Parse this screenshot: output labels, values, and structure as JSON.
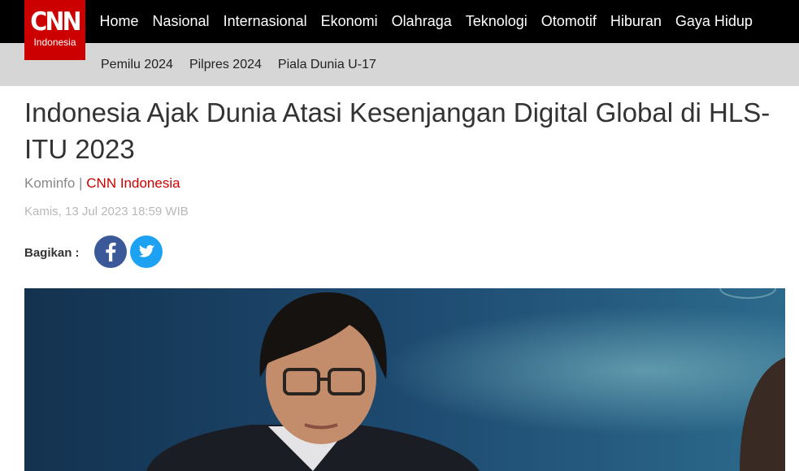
{
  "logo": {
    "mark": "CNN",
    "subtitle": "Indonesia",
    "color": "#cc0000"
  },
  "nav": {
    "main": [
      {
        "label": "Home"
      },
      {
        "label": "Nasional"
      },
      {
        "label": "Internasional"
      },
      {
        "label": "Ekonomi"
      },
      {
        "label": "Olahraga"
      },
      {
        "label": "Teknologi"
      },
      {
        "label": "Otomotif"
      },
      {
        "label": "Hiburan"
      },
      {
        "label": "Gaya Hidup"
      }
    ],
    "sub": [
      {
        "label": "Pemilu 2024"
      },
      {
        "label": "Pilpres 2024"
      },
      {
        "label": "Piala Dunia U-17"
      }
    ]
  },
  "article": {
    "title": "Indonesia Ajak Dunia Atasi Kesenjangan Digital Global di HLS-ITU 2023",
    "source": "Kominfo",
    "separator": "|",
    "brand": "CNN Indonesia",
    "date": "Kamis, 13 Jul 2023 18:59 WIB",
    "share_label": "Bagikan :",
    "share": [
      {
        "icon": "facebook-icon",
        "color": "#3b5998"
      },
      {
        "icon": "twitter-icon",
        "color": "#1da1f2"
      }
    ],
    "image": {
      "subject": "woman-speaking-at-conference-podium"
    }
  }
}
